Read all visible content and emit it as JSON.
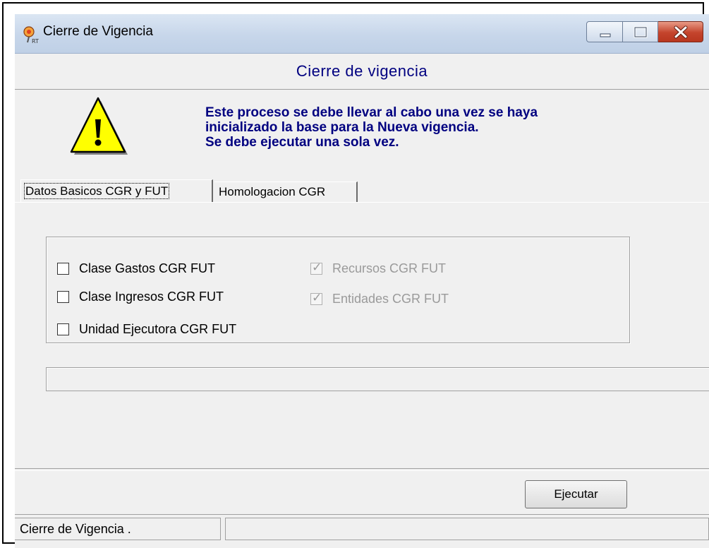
{
  "window": {
    "title": "Cierre de Vigencia"
  },
  "header": {
    "title": "Cierre de vigencia"
  },
  "warning": {
    "line1": "Este proceso se debe llevar al cabo una vez se haya",
    "line2": "inicializado la base para la Nueva vigencia.",
    "line3": "Se debe ejecutar una sola vez."
  },
  "tabs": [
    {
      "label": "Datos Basicos CGR y FUT",
      "active": true
    },
    {
      "label": "Homologacion CGR",
      "active": false
    }
  ],
  "options": {
    "left": [
      {
        "label": "Clase Gastos CGR FUT",
        "checked": false,
        "enabled": true
      },
      {
        "label": "Clase Ingresos CGR FUT",
        "checked": false,
        "enabled": true
      },
      {
        "label": "Unidad Ejecutora CGR FUT",
        "checked": false,
        "enabled": true
      }
    ],
    "right": [
      {
        "label": "Recursos CGR FUT",
        "checked": true,
        "enabled": false
      },
      {
        "label": "Entidades CGR FUT",
        "checked": true,
        "enabled": false
      }
    ]
  },
  "actions": {
    "execute_label": "Ejecutar"
  },
  "statusbar": {
    "text": "Cierre de Vigencia .",
    "text2": ""
  },
  "icons": {
    "app": "app-pin-icon",
    "warning": "warning-triangle-icon",
    "minimize": "minimize-icon",
    "maximize": "maximize-icon",
    "close": "close-icon"
  },
  "colors": {
    "heading": "#000080",
    "close_button": "#c4442c",
    "warning_fill": "#ffff00"
  }
}
